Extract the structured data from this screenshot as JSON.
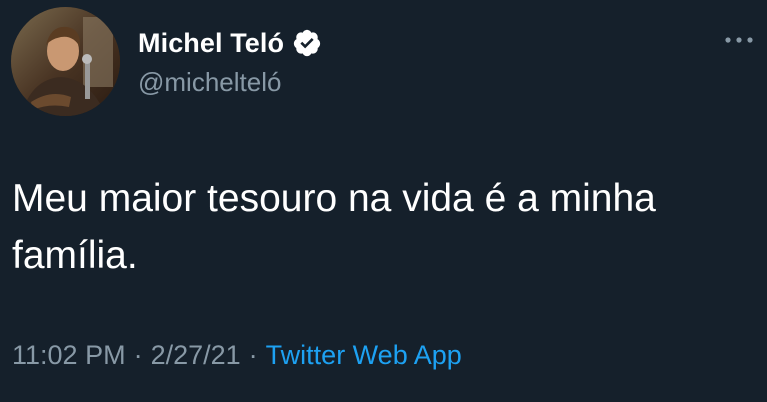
{
  "author": {
    "display_name": "Michel Teló",
    "handle": "@michelteló",
    "verified": true,
    "avatar_icon": "profile-photo"
  },
  "tweet": {
    "text": "Meu maior tesouro na vida é a minha família.",
    "time": "11:02 PM",
    "date": "2/27/21",
    "separator": "·",
    "source": "Twitter Web App"
  },
  "icons": {
    "verified": "verified-badge-icon",
    "more": "more-options-icon"
  },
  "colors": {
    "background": "#15202b",
    "primary_text": "#ffffff",
    "secondary_text": "#8899a6",
    "link": "#1da1f2"
  }
}
